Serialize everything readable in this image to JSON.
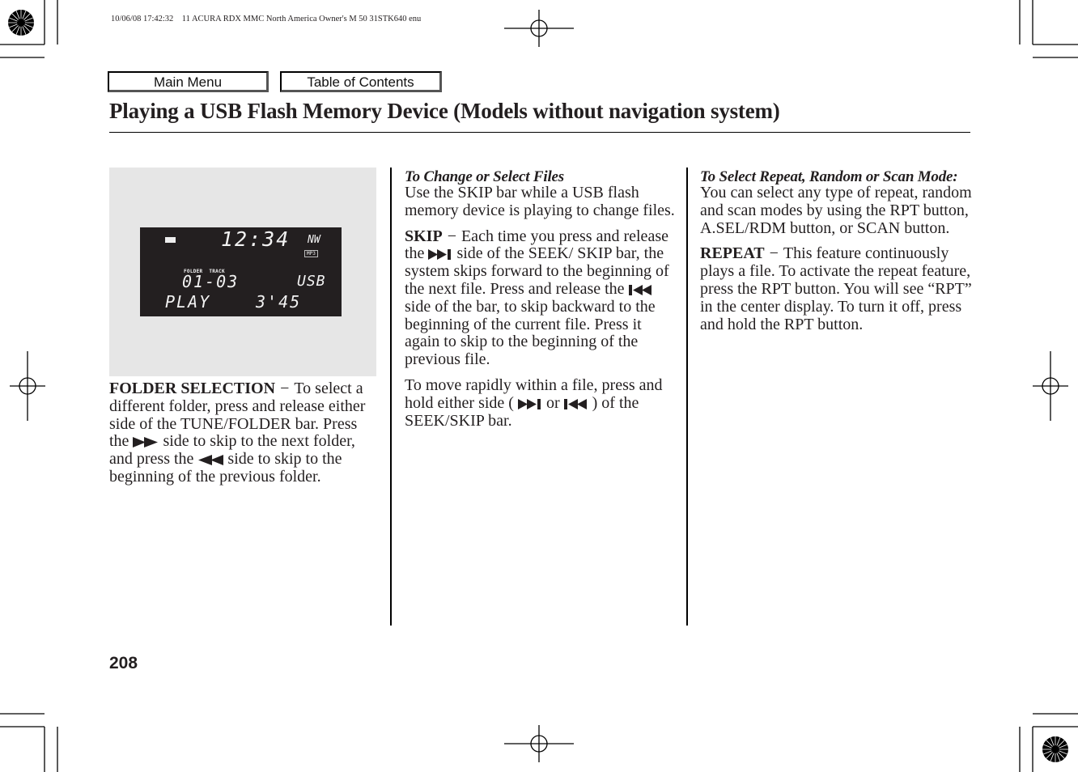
{
  "print_stamp": "10/06/08 17:42:32    11 ACURA RDX MMC North America Owner's M 50 31STK640 enu",
  "nav": {
    "main_menu_label": "Main Menu",
    "toc_label": "Table of Contents"
  },
  "page_title": "Playing a USB Flash Memory Device (Models without navigation system)",
  "figure": {
    "clock": "12:34",
    "nw_indicator": "NW",
    "format_badge": "MP3",
    "folder_label": "FOLDER",
    "track_label": "TRACK",
    "folder_track": "01-03",
    "source": "USB",
    "mode": "PLAY",
    "elapsed": "3'45",
    "usb_icon": "usb-icon"
  },
  "col1": {
    "term": "FOLDER SELECTION",
    "dash": "−",
    "t1": "To select a different folder, press and release either side of the TUNE/FOLDER bar. Press the",
    "icon1": "fast-forward-icon",
    "t2": "side to skip to the next folder, and press the",
    "icon2": "rewind-icon",
    "t3": "side to skip to the beginning of the previous folder."
  },
  "col2": {
    "heading": "To Change or Select Files",
    "intro": "Use the SKIP bar while a USB flash memory device is playing to change files.",
    "skip_term": "SKIP",
    "dash": "−",
    "skip_t1": "Each time you press and release the",
    "skip_icon1": "skip-next-icon",
    "skip_t2": "side of the SEEK/ SKIP bar, the system skips forward to the beginning of the next file. Press and release the",
    "skip_icon2": "skip-previous-icon",
    "skip_t3": "side of the bar, to skip backward to the beginning of the current file. Press it again to skip to the beginning of the previous file.",
    "move_t1": "To move rapidly within a file, press and hold either side (",
    "move_icon1": "skip-next-icon",
    "move_or": "or",
    "move_icon2": "skip-previous-icon",
    "move_t2": ") of the SEEK/SKIP bar."
  },
  "col3": {
    "heading": "To Select Repeat, Random or Scan Mode:",
    "intro": "You can select any type of repeat, random and scan modes by using the RPT button, A.SEL/RDM button, or SCAN button.",
    "repeat_term": "REPEAT",
    "dash": "−",
    "repeat_text": "This feature continuously plays a file. To activate the repeat feature, press the RPT button. You will see “RPT” in the center display. To turn it off, press and hold the RPT button."
  },
  "page_number": "208"
}
